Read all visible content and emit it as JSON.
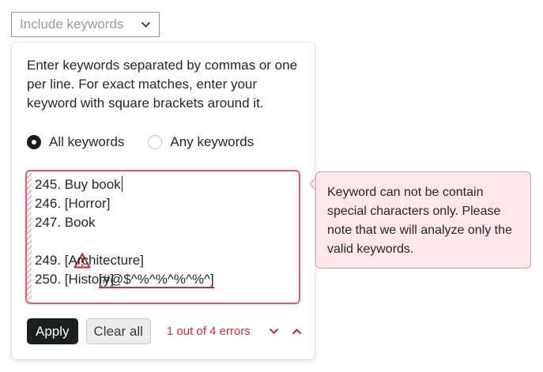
{
  "dropdown": {
    "label": "Include keywords",
    "icon": "chevron-down-icon"
  },
  "panel": {
    "instructions": "Enter keywords separated by commas or one per line. For exact matches, enter your keyword with square brackets around it.",
    "match_mode": {
      "options": [
        {
          "label": "All keywords",
          "selected": true
        },
        {
          "label": "Any keywords",
          "selected": false
        }
      ]
    },
    "keywords": {
      "lines": [
        {
          "text": "245. Buy book",
          "has_caret": true,
          "error": false
        },
        {
          "text": "246. [Horror]",
          "error": false
        },
        {
          "text": "247. Book",
          "error": false
        },
        {
          "text": "[#@$^%^%^%^%^]",
          "error": true,
          "icon": "warning-icon"
        },
        {
          "text": "249. [Architecture]",
          "error": false
        },
        {
          "text": "250. [History]",
          "error": false
        }
      ]
    },
    "actions": {
      "apply_label": "Apply",
      "clear_label": "Clear all",
      "error_status": "1 out of 4 errors"
    }
  },
  "tooltip": {
    "message": "Keyword can not be contain special characters only. Please note that we will analyze only the valid keywords."
  },
  "colors": {
    "error": "#c9303f",
    "error_border": "#e35b6d",
    "tooltip_bg": "#fde7ea",
    "dropdown_border": "#8b93d8",
    "apply_bg": "#1d1f1e"
  }
}
